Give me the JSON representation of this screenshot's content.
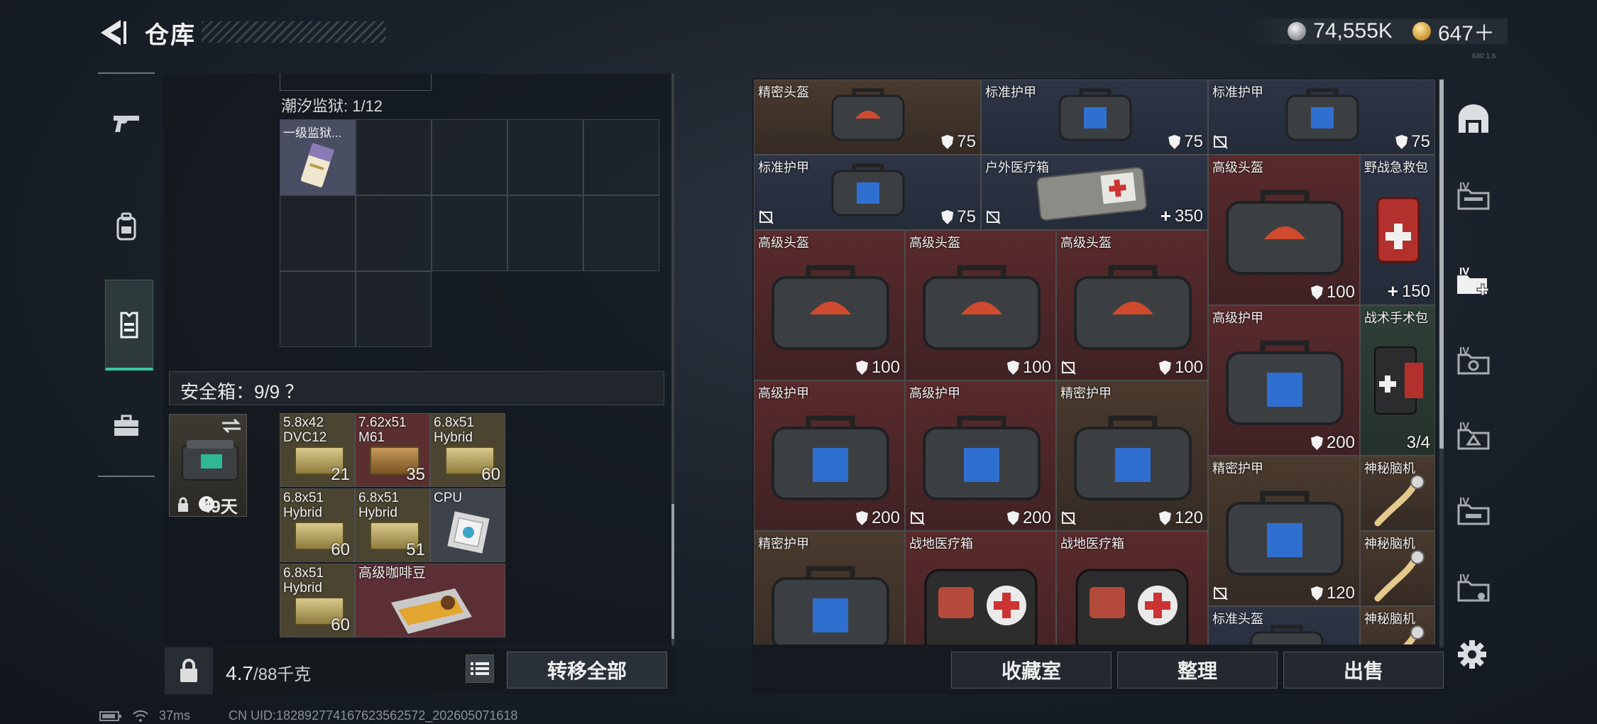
{
  "header": {
    "title": "仓库",
    "currency": [
      {
        "icon": "silver-coin-icon",
        "value": "74,555K"
      },
      {
        "icon": "gold-coin-icon",
        "value": "647＋"
      }
    ],
    "corner_text": "640 1.6"
  },
  "left_nav": [
    "gun-icon",
    "backpack-icon",
    "vest-icon",
    "briefcase-icon"
  ],
  "prison": {
    "label": "潮汐监狱: 1/12",
    "card_name": "一级监狱..."
  },
  "safe": {
    "label": "安全箱：9/9 ？",
    "days": "49天"
  },
  "safe_items": [
    {
      "name": "5.8x42 DVC12",
      "count": "21"
    },
    {
      "name": "7.62x51 M61",
      "count": "35"
    },
    {
      "name": "6.8x51 Hybrid",
      "count": "60"
    },
    {
      "name": "6.8x51 Hybrid",
      "count": "60"
    },
    {
      "name": "6.8x51 Hybrid",
      "count": "51"
    },
    {
      "name": "CPU",
      "count": ""
    },
    {
      "name": "6.8x51 Hybrid",
      "count": "60"
    },
    {
      "name": "高级咖啡豆",
      "count": ""
    }
  ],
  "bottom_left": {
    "weight": "4.7",
    "weight_unit": "/88千克",
    "transfer": "转移全部"
  },
  "inventory": [
    {
      "name": "精密头盔",
      "value": "75"
    },
    {
      "name": "标准护甲",
      "value": "75"
    },
    {
      "name": "标准护甲",
      "value": "75"
    },
    {
      "name": "标准护甲",
      "value": "75"
    },
    {
      "name": "户外医疗箱",
      "value": "350"
    },
    {
      "name": "高级头盔",
      "value": "100"
    },
    {
      "name": "野战急救包",
      "value": "150"
    },
    {
      "name": "高级头盔",
      "value": "100"
    },
    {
      "name": "高级头盔",
      "value": "100"
    },
    {
      "name": "高级头盔",
      "value": "100"
    },
    {
      "name": "高级护甲",
      "value": "200"
    },
    {
      "name": "战术手术包",
      "value": "3/4"
    },
    {
      "name": "高级护甲",
      "value": "200"
    },
    {
      "name": "高级护甲",
      "value": "200"
    },
    {
      "name": "精密护甲",
      "value": "120"
    },
    {
      "name": "精密护甲",
      "value": "120"
    },
    {
      "name": "神秘脑机",
      "value": ""
    },
    {
      "name": "精密护甲",
      "value": ""
    },
    {
      "name": "战地医疗箱",
      "value": ""
    },
    {
      "name": "战地医疗箱",
      "value": ""
    },
    {
      "name": "神秘脑机",
      "value": ""
    },
    {
      "name": "标准头盔",
      "value": ""
    },
    {
      "name": "神秘脑机",
      "value": ""
    }
  ],
  "right_nav": [
    "IV",
    "IV",
    "IV",
    "IV",
    "IV",
    "IV"
  ],
  "bottom_right": {
    "collection": "收藏室",
    "sort": "整理",
    "sell": "出售"
  },
  "status": {
    "ping": "37ms",
    "uid": "CN UID:18289277416762356257​2_202605071618"
  }
}
